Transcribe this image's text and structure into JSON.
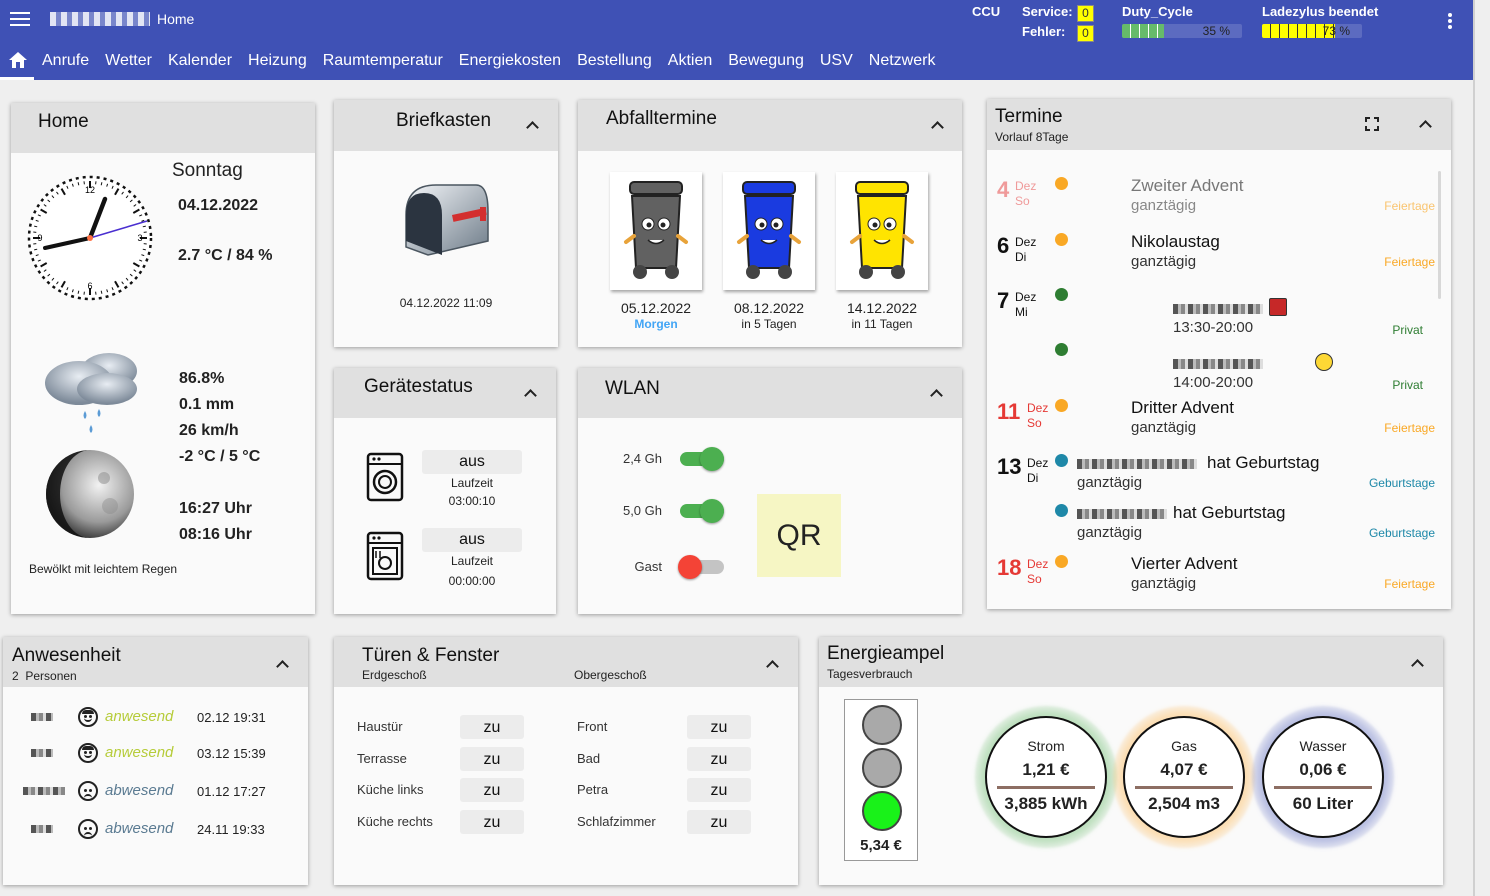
{
  "topbar": {
    "title": "Home",
    "ccu_label": "CCU",
    "service_label": "Service:",
    "service_value": "0",
    "fehler_label": "Fehler:",
    "fehler_value": "0",
    "duty_label": "Duty_Cycle",
    "duty_text": "35 %",
    "duty_percent": 35,
    "ladezyklus_label": "Ladezylus beendet",
    "ladezyklus_text": "73 %",
    "ladezyklus_percent": 73,
    "colors": {
      "bar": "#3f51b5",
      "duty_fill": "#66bb6a",
      "lade_fill": "#ffff00"
    }
  },
  "nav": {
    "tabs": [
      "Anrufe",
      "Wetter",
      "Kalender",
      "Heizung",
      "Raumtemperatur",
      "Energiekosten",
      "Bestellung",
      "Aktien",
      "Bewegung",
      "USV",
      "Netzwerk"
    ]
  },
  "home": {
    "title": "Home",
    "weekday": "Sonntag",
    "date": "04.12.2022",
    "temp_humidity": "2.7 °C / 84 %",
    "clock_hours": [
      "12",
      "3",
      "6",
      "9"
    ],
    "humidity": "86.8%",
    "rain": "0.1 mm",
    "wind": "26 km/h",
    "minmax": "-2 °C / 5 °C",
    "sunset": "16:27 Uhr",
    "sunrise": "08:16 Uhr",
    "weather_text": "Bewölkt mit leichtem Regen"
  },
  "briefkasten": {
    "title": "Briefkasten",
    "timestamp": "04.12.2022 11:09"
  },
  "abfall": {
    "title": "Abfalltermine",
    "bins": [
      {
        "date": "05.12.2022",
        "when": "Morgen",
        "color": "#616161"
      },
      {
        "date": "08.12.2022",
        "when": "in 5 Tagen",
        "color": "#1a3be0"
      },
      {
        "date": "14.12.2022",
        "when": "in 11 Tagen",
        "color": "#ffe400"
      }
    ]
  },
  "termine": {
    "title": "Termine",
    "subtitle": "Vorlauf 8Tage",
    "events": [
      {
        "day": "4",
        "mon": "Dez",
        "wd": "So",
        "title": "Zweiter Advent",
        "sub": "ganztägig",
        "cat": "Feiertage",
        "dot": "#f9a825"
      },
      {
        "day": "6",
        "mon": "Dez",
        "wd": "Di",
        "title": "Nikolaustag",
        "sub": "ganztägig",
        "cat": "Feiertage",
        "dot": "#f9a825"
      },
      {
        "day": "7",
        "mon": "Dez",
        "wd": "Mi",
        "title": "",
        "sub": "13:30-20:00",
        "cat": "Privat",
        "dot": "#2e7d32"
      },
      {
        "day": "",
        "mon": "",
        "wd": "",
        "title": "",
        "sub": "14:00-20:00",
        "cat": "Privat",
        "dot": "#2e7d32"
      },
      {
        "day": "11",
        "mon": "Dez",
        "wd": "So",
        "title": "Dritter Advent",
        "sub": "ganztägig",
        "cat": "Feiertage",
        "dot": "#f9a825"
      },
      {
        "day": "13",
        "mon": "Dez",
        "wd": "Di",
        "title": "hat Geburtstag",
        "sub": "ganztägig",
        "cat": "Geburtstage",
        "dot": "#1e88a8"
      },
      {
        "day": "",
        "mon": "",
        "wd": "",
        "title": "hat Geburtstag",
        "sub": "ganztägig",
        "cat": "Geburtstage",
        "dot": "#1e88a8"
      },
      {
        "day": "18",
        "mon": "Dez",
        "wd": "So",
        "title": "Vierter Advent",
        "sub": "ganztägig",
        "cat": "Feiertage",
        "dot": "#f9a825"
      }
    ]
  },
  "geraete": {
    "title": "Gerätestatus",
    "devices": [
      {
        "state": "aus",
        "label": "Laufzeit",
        "runtime": "03:00:10"
      },
      {
        "state": "aus",
        "label": "Laufzeit",
        "runtime": "00:00:00"
      }
    ]
  },
  "wlan": {
    "title": "WLAN",
    "networks": [
      {
        "label": "2,4 Gh",
        "on": true
      },
      {
        "label": "5,0 Gh",
        "on": true
      },
      {
        "label": "Gast",
        "on": false
      }
    ],
    "qr_label": "QR"
  },
  "anwesenheit": {
    "title": "Anwesenheit",
    "subtitle": "2  Personen",
    "persons": [
      {
        "status": "anwesend",
        "time": "02.12 19:31",
        "present": true
      },
      {
        "status": "anwesend",
        "time": "03.12 15:39",
        "present": true
      },
      {
        "status": "abwesend",
        "time": "01.12 17:27",
        "present": false
      },
      {
        "status": "abwesend",
        "time": "24.11 19:33",
        "present": false
      }
    ]
  },
  "tueren": {
    "title": "Türen & Fenster",
    "erdgeschoss": "Erdgeschoß",
    "obergeschoss": "Obergeschoß",
    "left": [
      {
        "name": "Haustür",
        "state": "zu"
      },
      {
        "name": "Terrasse",
        "state": "zu"
      },
      {
        "name": "Küche links",
        "state": "zu"
      },
      {
        "name": "Küche rechts",
        "state": "zu"
      }
    ],
    "right": [
      {
        "name": "Front",
        "state": "zu"
      },
      {
        "name": "Bad",
        "state": "zu"
      },
      {
        "name": "Petra",
        "state": "zu"
      },
      {
        "name": "Schlafzimmer",
        "state": "zu"
      }
    ]
  },
  "energie": {
    "title": "Energieampel",
    "subtitle": "Tagesverbrauch",
    "ampel_value": "5,34 €",
    "gauges": [
      {
        "name": "Strom",
        "cost": "1,21 €",
        "amount": "3,885 kWh",
        "glow": "#66bb6a"
      },
      {
        "name": "Gas",
        "cost": "4,07 €",
        "amount": "2,504 m3",
        "glow": "#ffb74d"
      },
      {
        "name": "Wasser",
        "cost": "0,06 €",
        "amount": "60 Liter",
        "glow": "#5c6bc0"
      }
    ]
  }
}
